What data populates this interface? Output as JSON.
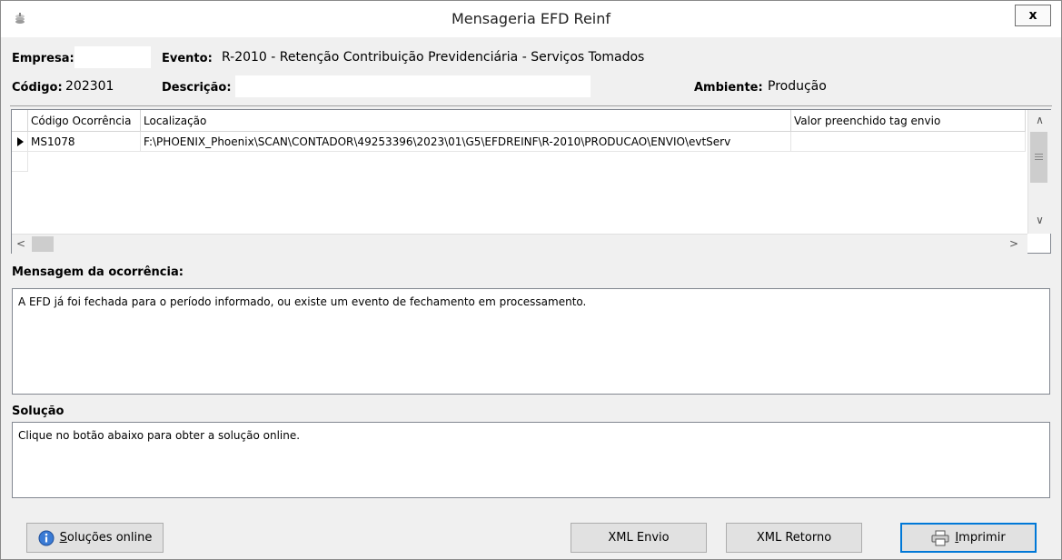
{
  "window": {
    "title": "Mensageria EFD Reinf",
    "close_label": "x"
  },
  "header": {
    "empresa_label": "Empresa:",
    "empresa_value": "",
    "evento_label": "Evento:",
    "evento_value": "R-2010 - Retenção Contribuição Previdenciária - Serviços Tomados",
    "codigo_label": "Código:",
    "codigo_value": "202301",
    "descricao_label": "Descrição:",
    "descricao_value": "",
    "ambiente_label": "Ambiente:",
    "ambiente_value": "Produção"
  },
  "grid": {
    "columns": [
      "Código Ocorrência",
      "Localização",
      "Valor preenchido tag envio"
    ],
    "rows": [
      [
        "MS1078",
        "F:\\PHOENIX_Phoenix\\SCAN\\CONTADOR\\49253396\\2023\\01\\G5\\EFDREINF\\R-2010\\PRODUCAO\\ENVIO\\evtServ",
        ""
      ]
    ]
  },
  "mensagem": {
    "label": "Mensagem da ocorrência:",
    "text": "A EFD já foi fechada para o período informado, ou existe um evento de fechamento em processamento."
  },
  "solucao": {
    "label": "Solução",
    "text": "Clique no botão abaixo para obter a solução online."
  },
  "buttons": {
    "solucoes_online": "Soluções online",
    "xml_envio": "XML Envio",
    "xml_retorno": "XML Retorno",
    "imprimir": "Imprimir"
  },
  "colors": {
    "accent": "#0078d7",
    "button_bg": "#e1e1e1",
    "window_bg": "#f0f0f0"
  }
}
